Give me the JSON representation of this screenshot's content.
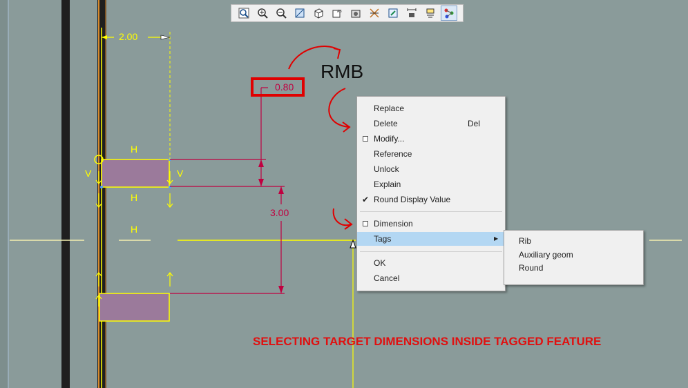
{
  "toolbar": {
    "buttons": [
      {
        "icon": "zoom-window-icon"
      },
      {
        "icon": "zoom-in-icon"
      },
      {
        "icon": "zoom-out-icon"
      },
      {
        "icon": "repaint-icon"
      },
      {
        "icon": "display-style-icon"
      },
      {
        "icon": "saved-views-icon"
      },
      {
        "icon": "annotation-display-icon"
      },
      {
        "icon": "sketch-display-icon"
      },
      {
        "icon": "refit-icon"
      },
      {
        "icon": "dimension-display-icon"
      },
      {
        "icon": "constraints-display-icon"
      },
      {
        "icon": "vertex-display-icon",
        "active": true
      }
    ]
  },
  "sketch": {
    "dim_horizontal": "2.00",
    "dim_selected": "0.80",
    "dim_vertical": "3.00",
    "constraint_h": "H",
    "constraint_v": "V"
  },
  "annotation": {
    "rmb_label": "RMB",
    "caption": "SELECTING TARGET DIMENSIONS INSIDE TAGGED FEATURE"
  },
  "context_menu": {
    "items": [
      {
        "label": "Replace"
      },
      {
        "label": "Delete",
        "shortcut": "Del"
      },
      {
        "label": "Modify...",
        "checkbox": "empty"
      },
      {
        "label": "Reference"
      },
      {
        "label": "Unlock"
      },
      {
        "label": "Explain"
      },
      {
        "label": "Round Display Value",
        "checkbox": "checked"
      },
      {
        "label": "Dimension",
        "checkbox": "empty"
      },
      {
        "label": "Tags",
        "highlighted": true,
        "submenu": true
      },
      {
        "label": "OK"
      },
      {
        "label": "Cancel"
      }
    ]
  },
  "tags_submenu": {
    "items": [
      {
        "label": "Rib"
      },
      {
        "label": "Auxiliary geom"
      },
      {
        "label": "Round"
      }
    ]
  },
  "colors": {
    "background": "#8a9b9a",
    "sketch_line": "#ffff00",
    "dimension": "#c00040",
    "fill": "#9b7a9b",
    "annotation_red": "#e00000"
  }
}
